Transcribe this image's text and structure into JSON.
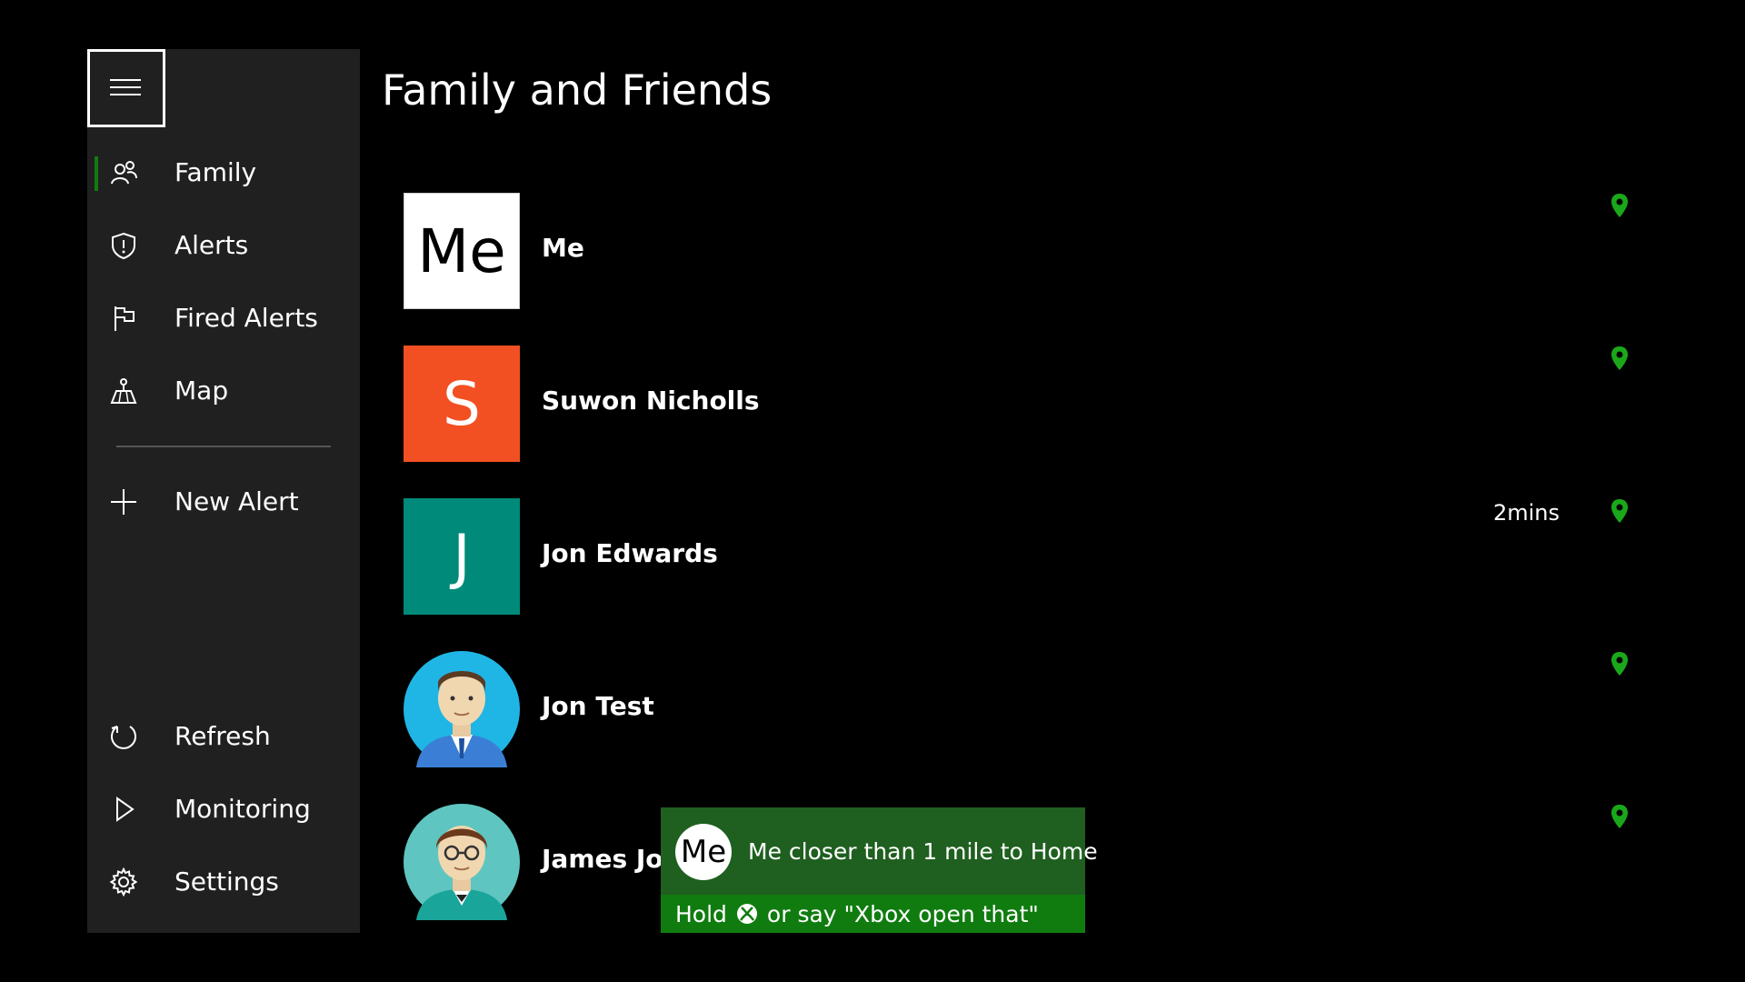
{
  "sidebar": {
    "menu_button_label": "",
    "items": [
      {
        "label": "Family",
        "icon": "family-icon"
      },
      {
        "label": "Alerts",
        "icon": "shield-icon"
      },
      {
        "label": "Fired Alerts",
        "icon": "flag-icon"
      },
      {
        "label": "Map",
        "icon": "map-icon"
      },
      {
        "label": "New Alert",
        "icon": "plus-icon"
      },
      {
        "label": "Refresh",
        "icon": "refresh-icon"
      },
      {
        "label": "Monitoring",
        "icon": "play-icon"
      },
      {
        "label": "Settings",
        "icon": "gear-icon"
      }
    ]
  },
  "page": {
    "title": "Family and Friends"
  },
  "members": [
    {
      "initials": "Me",
      "name": "Me",
      "time": "",
      "avatar_color": "#ffffff"
    },
    {
      "initials": "S",
      "name": "Suwon Nicholls",
      "time": "",
      "avatar_color": "#f25022"
    },
    {
      "initials": "J",
      "name": "Jon Edwards",
      "time": "2mins",
      "avatar_color": "#008a7a"
    },
    {
      "initials": "",
      "name": "Jon Test",
      "time": "",
      "avatar_color": "#1fb6e6"
    },
    {
      "initials": "",
      "name": "James Jon",
      "time": "",
      "avatar_color": "#5fc5c0"
    }
  ],
  "toast": {
    "avatar_initials": "Me",
    "message": "Me closer than 1 mile to Home",
    "hint_prefix": "Hold",
    "hint_suffix": "or say \"Xbox open that\""
  },
  "colors": {
    "accent": "#107c10",
    "pin": "#1aa81a"
  }
}
